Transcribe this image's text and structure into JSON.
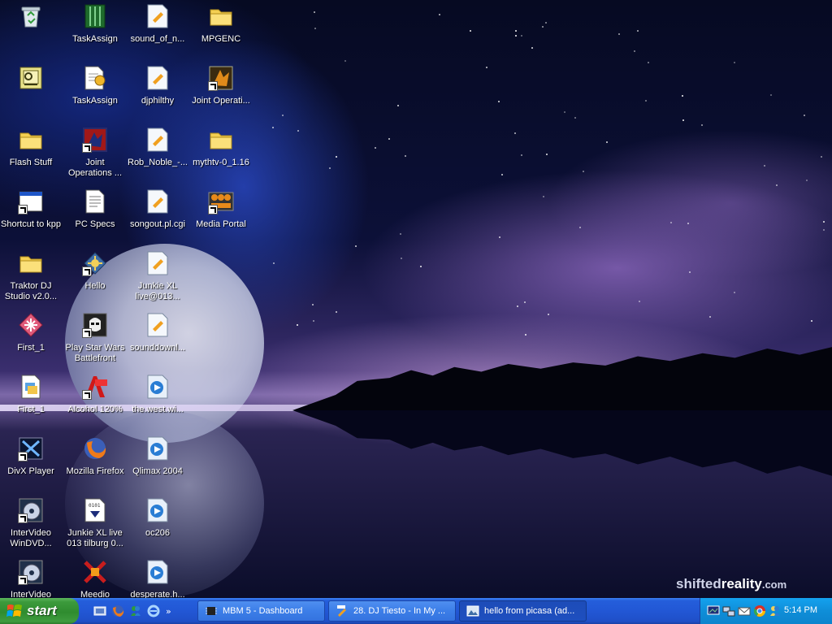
{
  "desktop": {
    "watermark": {
      "part1": "shifted",
      "part2": "reality",
      "part3": ".com"
    },
    "icons": [
      {
        "label": "",
        "icon": "recycle-bin-icon"
      },
      {
        "label": "",
        "icon": "app-icon"
      },
      {
        "label": "Flash Stuff",
        "icon": "folder-icon"
      },
      {
        "label": "Shortcut to kpp",
        "icon": "window-icon"
      },
      {
        "label": "Traktor DJ Studio v2.0...",
        "icon": "folder-icon"
      },
      {
        "label": "First_1",
        "icon": "app-icon"
      },
      {
        "label": "First_1",
        "icon": "document-icon"
      },
      {
        "label": "DivX Player",
        "icon": "divx-icon"
      },
      {
        "label": "InterVideo WinDVD...",
        "icon": "dvd-icon"
      },
      {
        "label": "InterVideo",
        "icon": "dvd-icon"
      },
      {
        "label": "TaskAssign",
        "icon": "app-icon"
      },
      {
        "label": "TaskAssign",
        "icon": "document-icon"
      },
      {
        "label": "Joint Operations ...",
        "icon": "game-icon"
      },
      {
        "label": "PC Specs",
        "icon": "text-file-icon"
      },
      {
        "label": "Hello",
        "icon": "app-icon"
      },
      {
        "label": "Play Star Wars Battlefront",
        "icon": "game-icon"
      },
      {
        "label": "Alcohol 120%",
        "icon": "alcohol-icon"
      },
      {
        "label": "Mozilla Firefox",
        "icon": "firefox-icon"
      },
      {
        "label": "Junkie XL live 013 tilburg 0...",
        "icon": "text-file-icon"
      },
      {
        "label": "Meedio",
        "icon": "app-icon"
      },
      {
        "label": "sound_of_n...",
        "icon": "media-file-icon"
      },
      {
        "label": "djphilthy",
        "icon": "media-file-icon"
      },
      {
        "label": "Rob_Noble_-...",
        "icon": "media-file-icon"
      },
      {
        "label": "songout.pl.cgi",
        "icon": "media-file-icon"
      },
      {
        "label": "Junkie XL live@013...",
        "icon": "media-file-icon"
      },
      {
        "label": "sounddownl...",
        "icon": "media-file-icon"
      },
      {
        "label": "the.west.wi...",
        "icon": "media-player-icon"
      },
      {
        "label": "Qlimax 2004",
        "icon": "media-player-icon"
      },
      {
        "label": "oc206",
        "icon": "media-player-icon"
      },
      {
        "label": "desperate.h...",
        "icon": "media-player-icon"
      },
      {
        "label": "MPGENC",
        "icon": "folder-icon"
      },
      {
        "label": "Joint Operati...",
        "icon": "game-icon"
      },
      {
        "label": "mythtv-0_1.16",
        "icon": "folder-icon"
      },
      {
        "label": "Media Portal",
        "icon": "app-icon"
      }
    ]
  },
  "taskbar": {
    "start_label": "start",
    "quick_launch": [
      "show-desktop-icon",
      "firefox-icon",
      "messenger-icon",
      "ie-icon"
    ],
    "more_label": "»",
    "buttons": [
      {
        "label": "MBM 5 - Dashboard",
        "active": false
      },
      {
        "label": "28. DJ Tiesto - In My ...",
        "active": false
      },
      {
        "label": "hello from picasa (ad...",
        "active": true
      }
    ],
    "tray_icons": [
      "monitor-icon",
      "network-icon",
      "mail-icon",
      "chrome-icon",
      "messenger-icon"
    ],
    "clock": "5:14 PM"
  }
}
